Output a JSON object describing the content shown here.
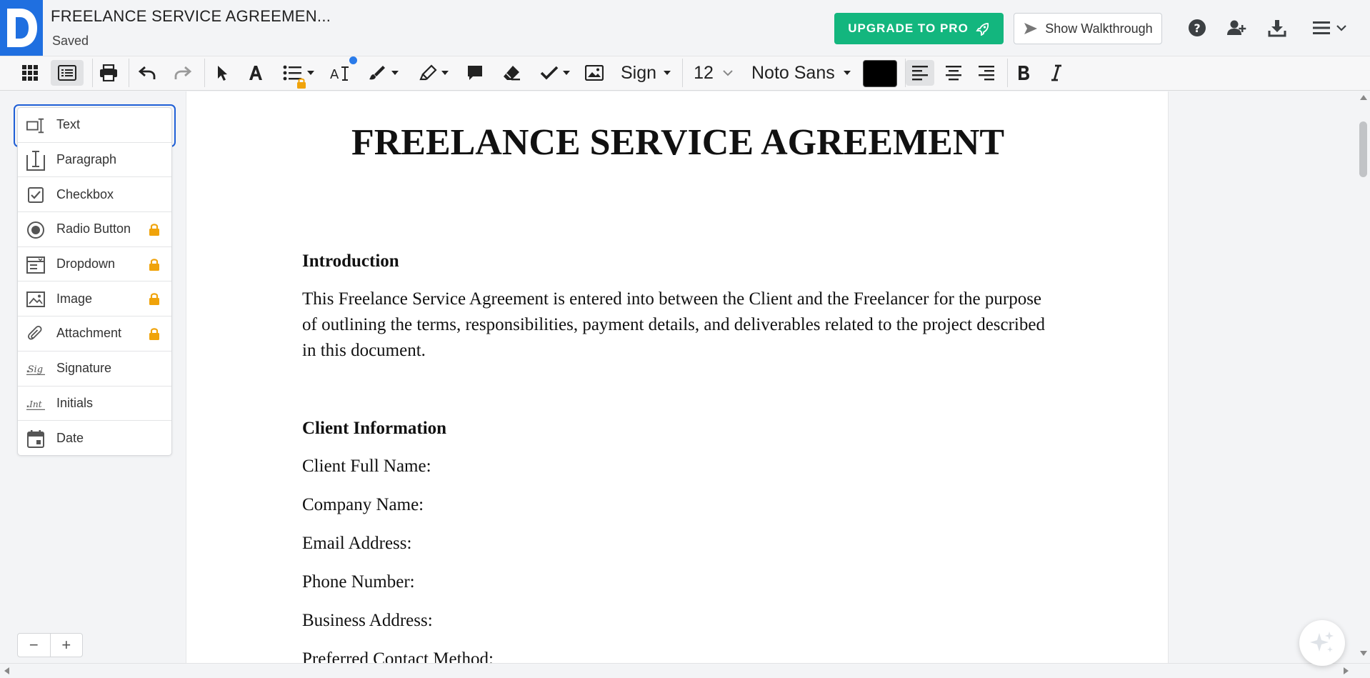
{
  "header": {
    "title": "FREELANCE SERVICE AGREEMEN...",
    "status": "Saved",
    "upgrade_label": "UPGRADE TO PRO",
    "walkthrough_label": "Show Walkthrough"
  },
  "toolbar": {
    "sign_label": "Sign",
    "font_size": "12",
    "font_family": "Noto Sans",
    "text_color": "#000000"
  },
  "fields": {
    "items": [
      {
        "label": "Text",
        "locked": false
      },
      {
        "label": "Paragraph",
        "locked": false
      },
      {
        "label": "Checkbox",
        "locked": false
      },
      {
        "label": "Radio Button",
        "locked": true
      },
      {
        "label": "Dropdown",
        "locked": true
      },
      {
        "label": "Image",
        "locked": true
      },
      {
        "label": "Attachment",
        "locked": true
      },
      {
        "label": "Signature",
        "locked": false
      },
      {
        "label": "Initials",
        "locked": false
      },
      {
        "label": "Date",
        "locked": false
      }
    ],
    "selected": "Text"
  },
  "zoom": {
    "minus": "−",
    "plus": "+"
  },
  "document": {
    "heading": "FREELANCE SERVICE AGREEMENT",
    "intro_heading": "Introduction",
    "intro_text": "This Freelance Service Agreement is entered into between the Client and the Freelancer for the purpose of outlining the terms, responsibilities, payment details, and deliverables related to the project described in this document.",
    "client_heading": "Client Information",
    "client_fields": [
      "Client Full Name:",
      "Company Name:",
      "Email Address:",
      "Phone Number:",
      "Business Address:",
      "Preferred Contact Method:"
    ]
  },
  "colors": {
    "brand": "#1f6fe0",
    "upgrade": "#13b67e",
    "selection": "#1f5fd6",
    "lock": "#f0a30a"
  }
}
